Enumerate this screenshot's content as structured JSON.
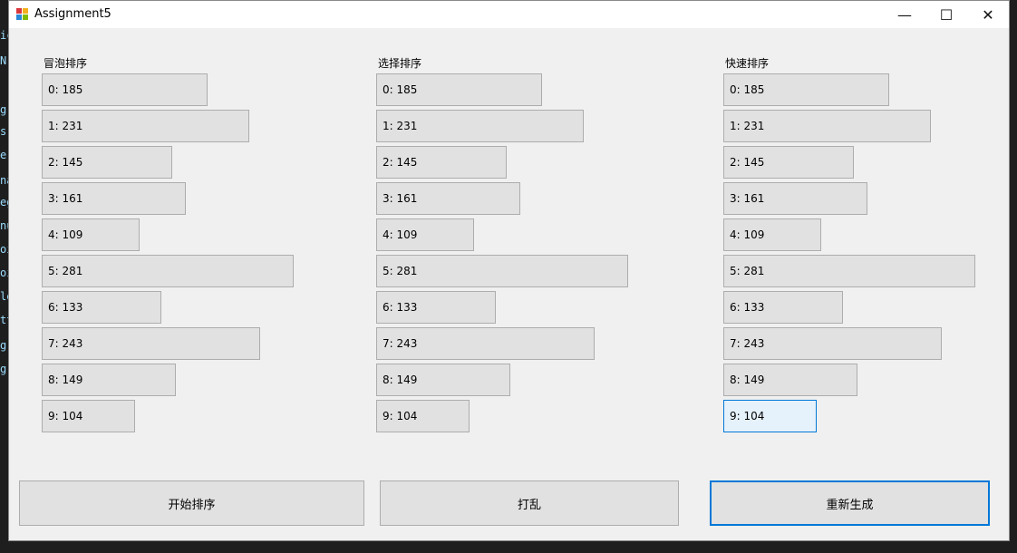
{
  "window": {
    "title": "Assignment5",
    "controls": {
      "minimize": "—",
      "maximize": "☐",
      "close": "✕"
    }
  },
  "background_text": [
    "ic",
    "N",
    "g",
    "s",
    "e",
    "na",
    "eg",
    "nu",
    "oi",
    "oi",
    "le",
    "tt",
    "g",
    "g"
  ],
  "columns": [
    {
      "label": "冒泡排序",
      "bars": [
        "0: 185",
        "1: 231",
        "2: 145",
        "3: 161",
        "4: 109",
        "5: 281",
        "6: 133",
        "7: 243",
        "8: 149",
        "9: 104"
      ]
    },
    {
      "label": "选择排序",
      "bars": [
        "0: 185",
        "1: 231",
        "2: 145",
        "3: 161",
        "4: 109",
        "5: 281",
        "6: 133",
        "7: 243",
        "8: 149",
        "9: 104"
      ]
    },
    {
      "label": "快速排序",
      "bars": [
        "0: 185",
        "1: 231",
        "2: 145",
        "3: 161",
        "4: 109",
        "5: 281",
        "6: 133",
        "7: 243",
        "8: 149",
        "9: 104"
      ]
    }
  ],
  "values": [
    185,
    231,
    145,
    161,
    109,
    281,
    133,
    243,
    149,
    104
  ],
  "buttons": {
    "start": "开始排序",
    "shuffle": "打乱",
    "regenerate": "重新生成"
  },
  "colors": {
    "accent": "#0078d7",
    "bar": "#e1e1e1",
    "focus_bar": "#e5f1fb"
  }
}
